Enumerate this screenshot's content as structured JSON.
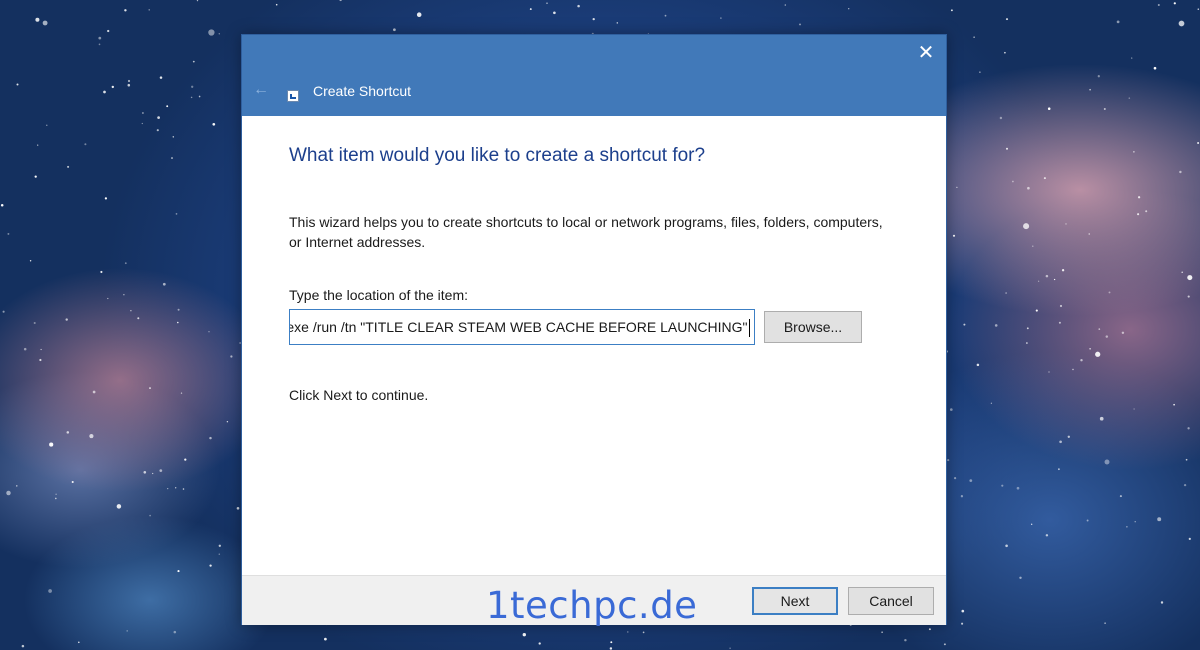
{
  "window": {
    "title": "Create Shortcut",
    "close_glyph": "✕",
    "back_glyph": "←",
    "icons": {
      "back": "back-arrow-icon",
      "app": "shortcut-icon",
      "close": "close-icon"
    }
  },
  "content": {
    "heading": "What item would you like to create a shortcut for?",
    "description": "This wizard helps you to create shortcuts to local or network programs, files, folders, computers, or Internet addresses.",
    "location_label": "Type the location of the item:",
    "location_value": "schtasks.exe /run /tn \"TITLE CLEAR STEAM WEB CACHE BEFORE LAUNCHING\"",
    "browse_label": "Browse...",
    "hint": "Click Next to continue."
  },
  "footer": {
    "next_label": "Next",
    "cancel_label": "Cancel"
  },
  "watermark": "1techpc.de",
  "colors": {
    "titlebar": "#4179b9",
    "heading": "#1c3f8c",
    "focus_border": "#3c7fc4",
    "watermark": "#3a6ad6"
  }
}
